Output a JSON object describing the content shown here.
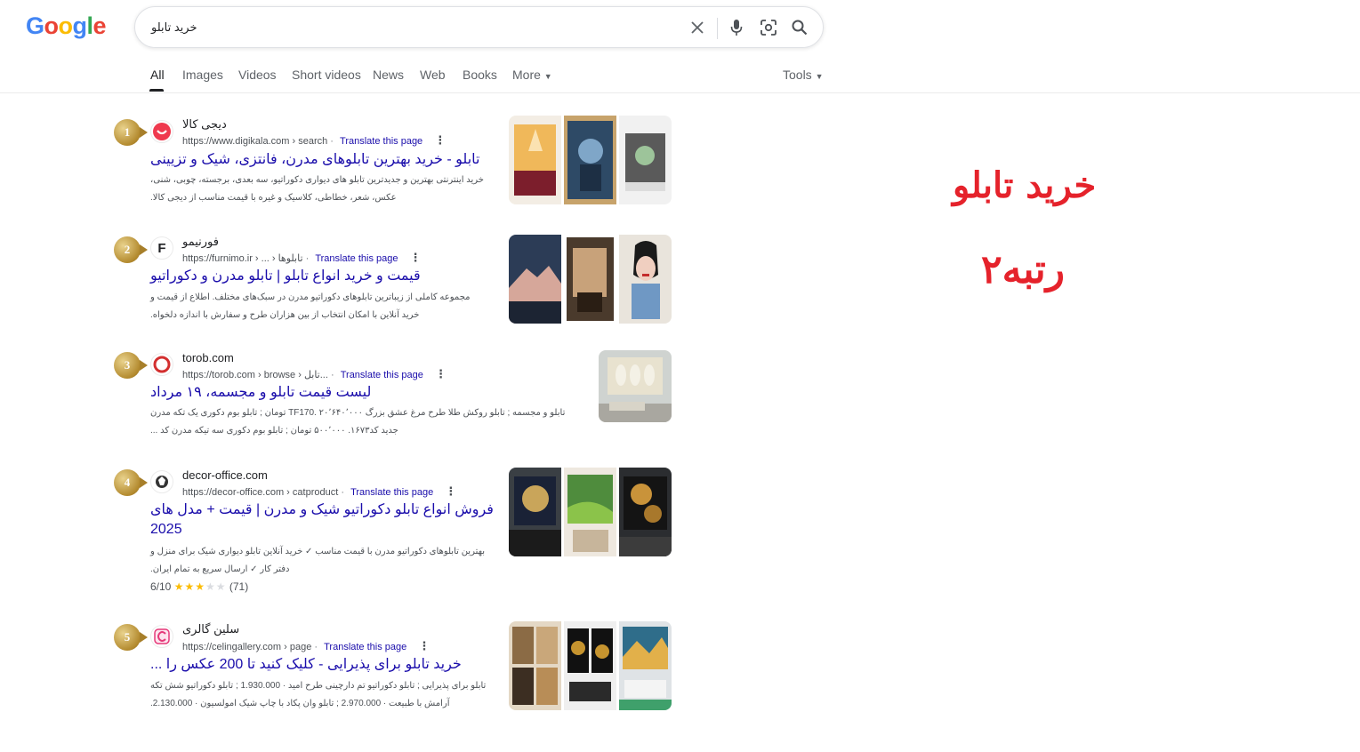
{
  "logo": {
    "letters": [
      "G",
      "o",
      "o",
      "g",
      "l",
      "e"
    ],
    "colors": [
      "#4285F4",
      "#EA4335",
      "#FBBC05",
      "#4285F4",
      "#34A853",
      "#EA4335"
    ]
  },
  "search": {
    "query": "خرید تابلو"
  },
  "tabs": [
    {
      "label": "All",
      "active": true
    },
    {
      "label": "Images"
    },
    {
      "label": "Videos"
    },
    {
      "label": "Short videos"
    },
    {
      "label": "News"
    },
    {
      "label": "Web"
    },
    {
      "label": "Books"
    },
    {
      "label": "More"
    }
  ],
  "tools_label": "Tools",
  "translate_label": "Translate this page",
  "results": [
    {
      "rank": "1",
      "site": "دیجی کالا",
      "url": "https://www.digikala.com › search",
      "title": "تابلو - خرید بهترین تابلوهای مدرن، فانتزی، شیک و تزیینی",
      "snippet": "خرید اینترنتی بهترین و جدیدترین تابلو های دیواری دکوراتیو، سه بعدی، برجسته، چوبی، شنی، عکس، شعر، خطاطی، کلاسیک و غیره با قیمت مناسب از دیجی کالا.",
      "favicon_color": "#ef394e"
    },
    {
      "rank": "2",
      "site": "فورنیمو",
      "url": "https://furnimo.ir › ... › تابلوها",
      "title": "قیمت و خرید انواع تابلو | تابلو مدرن و دکوراتیو",
      "snippet": "مجموعه کاملی از زیباترین تابلوهای دکوراتیو مدرن در سبک‌های مختلف. اطلاع از قیمت و خرید آنلاین با امکان انتخاب از بین هزاران طرح و سفارش با اندازه دلخواه.",
      "favicon_color": "#202124"
    },
    {
      "rank": "3",
      "site": "torob.com",
      "url": "https://torob.com › browse › تابل...",
      "title": "لیست قیمت تابلو و مجسمه، ۱۹ مرداد",
      "snippet": "تابلو و مجسمه ; تابلو روکش طلا طرح مرغ عشق بزرگ TF170. ۲۰٬۶۴۰٬۰۰۰ تومان ; تابلو بوم دکوری یک تکه مدرن جدید کد۱۶۷۳. ۵۰۰٬۰۰۰ تومان ; تابلو بوم دکوری سه تیکه مدرن کد ...",
      "favicon_color": "#d32f2f"
    },
    {
      "rank": "4",
      "site": "decor-office.com",
      "url": "https://decor-office.com › catproduct",
      "title": "فروش انواع تابلو دکوراتیو شیک و مدرن | قیمت + مدل های 2025",
      "snippet": "بهترین تابلوهای دکوراتیو مدرن با قیمت مناسب ✓ خرید آنلاین تابلو دیواری شیک برای منزل و دفتر کار ✓ ارسال سریع به تمام ایران.",
      "rating_text": "6/10",
      "rating_stars": 3,
      "rating_count": "(71)",
      "favicon_color": "#333333"
    },
    {
      "rank": "5",
      "site": "سلین گالری",
      "url": "https://celingallery.com › page",
      "title": "خرید تابلو برای پذیرایی - کلیک کنید تا 200 عکس را ...",
      "snippet": "تابلو برای پذیرایی ; تابلو دکوراتیو تم دارچینی طرح امید · 1.930.000 ; تابلو دکوراتیو شش تکه آرامش با طبیعت · 2.970.000 ; تابلو وان پکاد با چاپ شیک امولسیون · 2.130.000.",
      "favicon_color": "#e53a7a"
    }
  ],
  "overlay": {
    "line1": "خرید تابلو",
    "line2": "رتبه۲",
    "color": "#e5222b"
  }
}
